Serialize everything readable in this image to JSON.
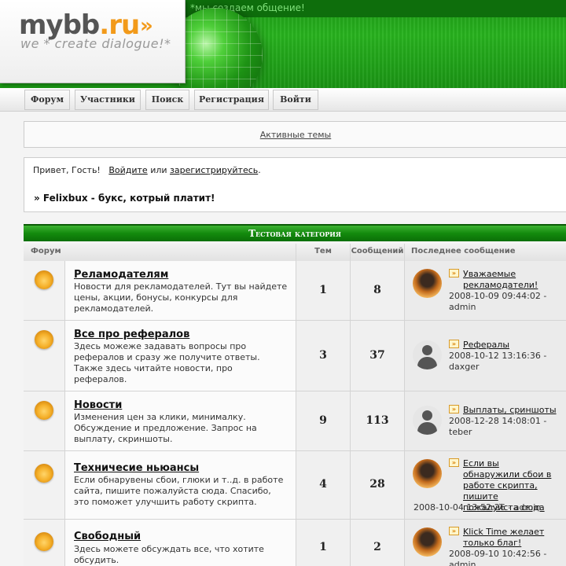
{
  "header": {
    "logo_main": "mybb",
    "logo_tld": ".ru",
    "logo_arrows": "»",
    "logo_tagline": "we * create dialogue!*",
    "top_tagline": "*мы создаем общение!"
  },
  "nav": [
    "Форум",
    "Участники",
    "Поиск",
    "Регистрация",
    "Войти"
  ],
  "active_topics": "Активные темы",
  "welcome": {
    "greeting": "Привет, Гость!",
    "login": "Войдите",
    "or": "или",
    "register": "зарегистрируйтесь",
    "end": ".",
    "announcement": "» Felixbux - букс, котрый платит!"
  },
  "category": {
    "title": "Тестовая категория",
    "columns": [
      "Форум",
      "Тем",
      "Сообщений",
      "Последнее сообщение"
    ]
  },
  "forums": [
    {
      "title": "Реламодателям",
      "desc": [
        "Новости для рекламодателей. Тут вы найдете",
        "цены, акции, бонусы, конкурсы для",
        "рекламодателей."
      ],
      "topics": "1",
      "posts": "8",
      "avatar": "photo",
      "last_title": [
        "Уважаемые",
        "рекламодатели!"
      ],
      "last_meta": [
        "2008-10-09 09:44:02 -",
        "admin"
      ]
    },
    {
      "title": "Все про рефералов",
      "desc": [
        "Здесь можеже задавать вопросы про",
        "рефералов и сразу же получите ответы.",
        "Также здесь читайте новости, про",
        "рефералов."
      ],
      "topics": "3",
      "posts": "37",
      "avatar": "default",
      "last_title": [
        "Рефералы"
      ],
      "last_meta": [
        "2008-10-12 13:16:36 -",
        "daxger"
      ]
    },
    {
      "title": "Новости",
      "desc": [
        "Изменения цен за клики, минималку.",
        "Обсуждение и предложение. Запрос на",
        "выплату, скриншоты."
      ],
      "topics": "9",
      "posts": "113",
      "avatar": "default",
      "last_title": [
        "Выплаты, сриншоты"
      ],
      "last_meta": [
        "2008-12-28 14:08:01 -",
        "teber"
      ]
    },
    {
      "title": "Техничесие ньюансы",
      "desc": [
        "Если обнарувены сбои, глюки и т..д. в работе",
        "сайта, пишите пожалуйста сюда. Спасибо,",
        "это поможет улучшить работу скрипта."
      ],
      "topics": "4",
      "posts": "28",
      "avatar": "photo",
      "last_title": [
        "Если вы",
        "обнаружили сбои в",
        "работе скрипта, пишите",
        "пожалуйста сюда"
      ],
      "last_meta": [
        "2008-10-04 13:52:26 - admin"
      ]
    },
    {
      "title": "Свободный",
      "desc": [
        "Здесь можете обсуждать все, что хотите",
        "обсудить."
      ],
      "topics": "1",
      "posts": "2",
      "avatar": "photo",
      "last_title": [
        "Klick Time желает",
        "только благ!"
      ],
      "last_meta": [
        "2008-09-10 10:42:56 -",
        "admin"
      ]
    }
  ]
}
